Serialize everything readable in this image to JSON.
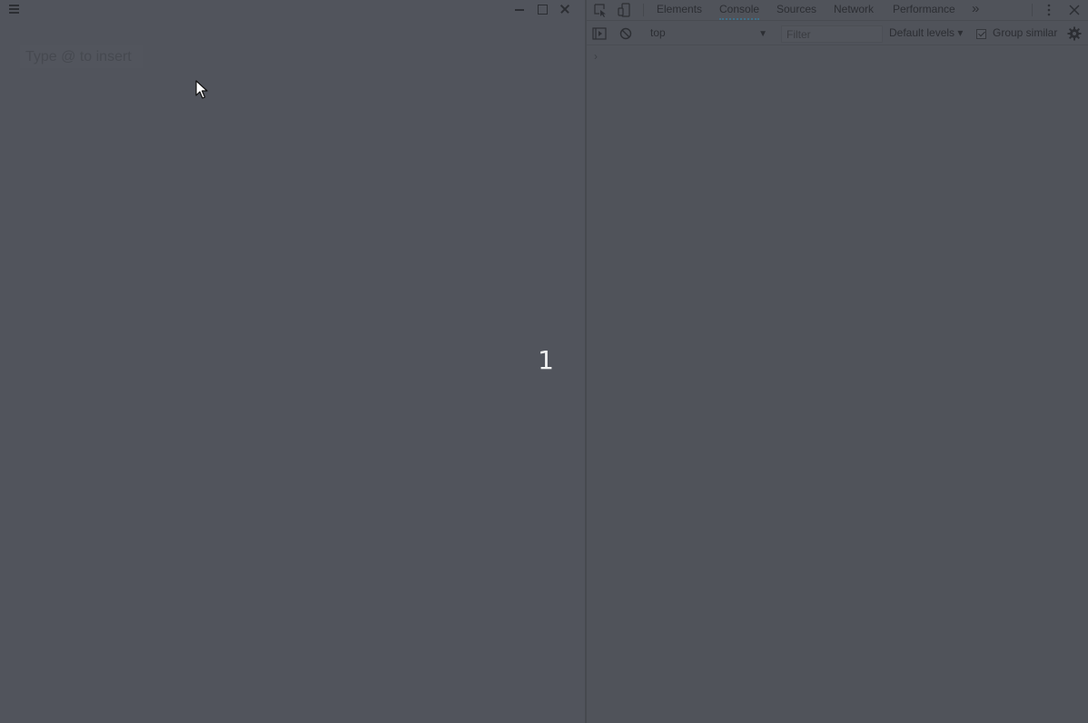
{
  "app": {
    "editor_placeholder": "Type @ to insert",
    "slide_number": "1"
  },
  "devtools": {
    "tabs": [
      {
        "label": "Elements"
      },
      {
        "label": "Console"
      },
      {
        "label": "Sources"
      },
      {
        "label": "Network"
      },
      {
        "label": "Performance"
      }
    ],
    "active_tab": "Console",
    "more_tabs_glyph": "»",
    "context": "top",
    "filter_placeholder": "Filter",
    "levels": "Default levels ▾",
    "group_similar": "Group similar",
    "group_similar_checked": true,
    "prompt": "›"
  },
  "colors": {
    "background": "#51545c",
    "text": "#2c2e33",
    "slide_number": "#f2f2f2",
    "active_tab_underline": "#3f6f88"
  }
}
